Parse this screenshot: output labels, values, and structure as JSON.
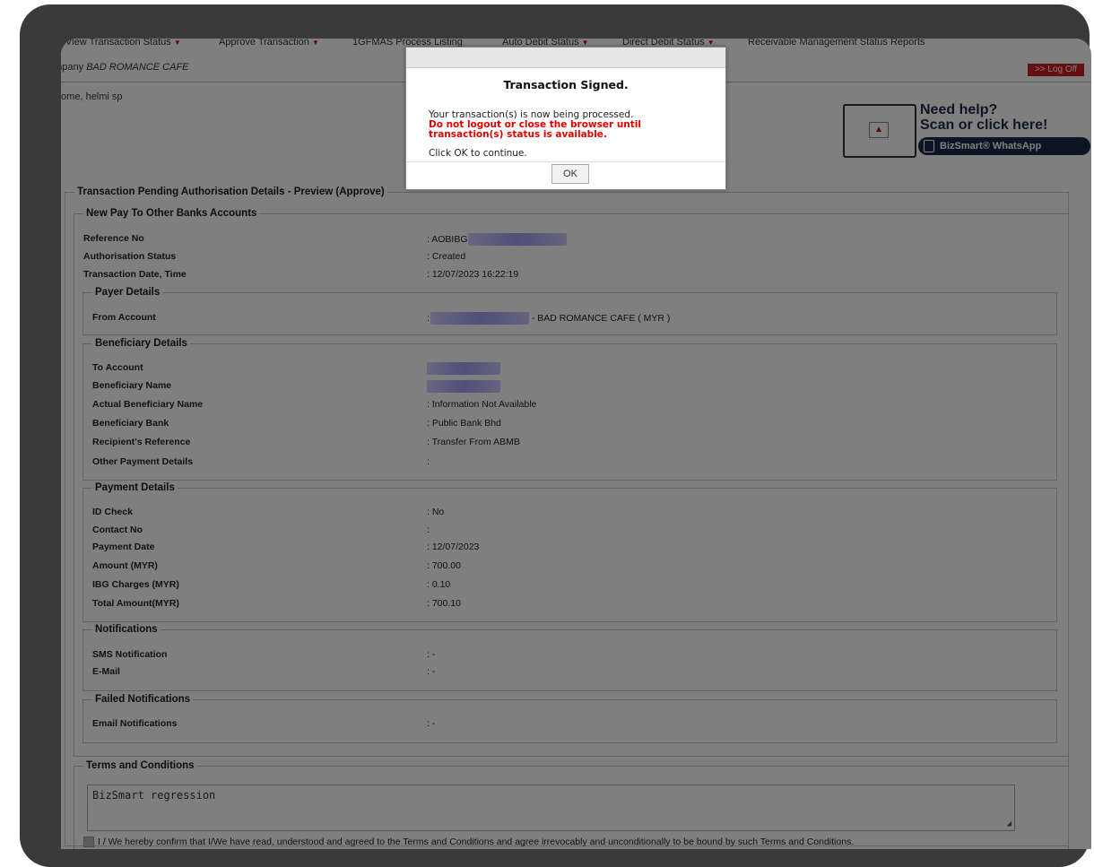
{
  "nav": {
    "items": [
      {
        "label": "View Transaction Status",
        "dropdown": true
      },
      {
        "label": "Approve Transaction",
        "dropdown": true
      },
      {
        "label": "1GFMAS Process Listing",
        "dropdown": false
      },
      {
        "label": "Auto Debit Status",
        "dropdown": true
      },
      {
        "label": "Direct Debit Status",
        "dropdown": true
      },
      {
        "label": "Receivable Management Status Reports",
        "dropdown": false
      }
    ],
    "caret": "▼"
  },
  "company": {
    "label": "ompany",
    "name": "BAD ROMANCE CAFE"
  },
  "logoff_label": ">> Log Off",
  "welcome": "elcome, helmi sp",
  "help": {
    "title": "Need help?",
    "subtitle": "Scan or click here!",
    "whatsapp_label": "BizSmart® WhatsApp"
  },
  "main_legend": "Transaction Pending Authorisation Details - Preview (Approve)",
  "section_legend": "New Pay To Other Banks Accounts",
  "summary": {
    "reference_label": "Reference No",
    "reference_value": ": AOBIBG",
    "auth_status_label": "Authorisation Status",
    "auth_status_value": ": Created",
    "txn_date_label": "Transaction Date, Time",
    "txn_date_value": ": 12/07/2023 16:22:19"
  },
  "payer": {
    "legend": "Payer Details",
    "from_account_label": "From Account",
    "from_account_prefix": ":",
    "from_account_suffix": "- BAD ROMANCE CAFE ( MYR )"
  },
  "beneficiary": {
    "legend": "Beneficiary Details",
    "to_account_label": "To Account",
    "name_label": "Beneficiary Name",
    "actual_name_label": "Actual Beneficiary Name",
    "actual_name_value": ": Information Not Available",
    "bank_label": "Beneficiary Bank",
    "bank_value": ": Public Bank Bhd",
    "recipient_ref_label": "Recipient's Reference",
    "recipient_ref_value": ": Transfer From ABMB",
    "other_details_label": "Other Payment Details",
    "other_details_value": ":"
  },
  "payment": {
    "legend": "Payment Details",
    "id_check_label": "ID Check",
    "id_check_value": ": No",
    "contact_label": "Contact No",
    "contact_value": ":",
    "date_label": "Payment Date",
    "date_value": ": 12/07/2023",
    "amount_label": "Amount (MYR)",
    "amount_value": ": 700.00",
    "charges_label": "IBG Charges (MYR)",
    "charges_value": ": 0.10",
    "total_label": "Total Amount(MYR)",
    "total_value": ": 700.10"
  },
  "notifications": {
    "legend": "Notifications",
    "sms_label": "SMS Notification",
    "sms_value": ": -",
    "email_label": "E-Mail",
    "email_value": ": -"
  },
  "failed_notifications": {
    "legend": "Failed Notifications",
    "email_label": "Email Notifications",
    "email_value": ": -"
  },
  "terms": {
    "legend": "Terms and Conditions",
    "text": "BizSmart regression",
    "agree_text": "I / We hereby confirm that I/We have read, understood and agreed to the Terms and Conditions and agree irrevocably and unconditionally to be bound by such Terms and Conditions."
  },
  "dialog": {
    "title": "Transaction Signed.",
    "message": "Your transaction(s) is now being processed.",
    "warning": "Do not logout or close the browser until transaction(s) status is available.",
    "continue_text": "Click OK to continue.",
    "ok_label": "OK"
  },
  "colors": {
    "warning": "#e00000",
    "logoff": "#c82020",
    "help_navy": "#1b2a4a"
  }
}
